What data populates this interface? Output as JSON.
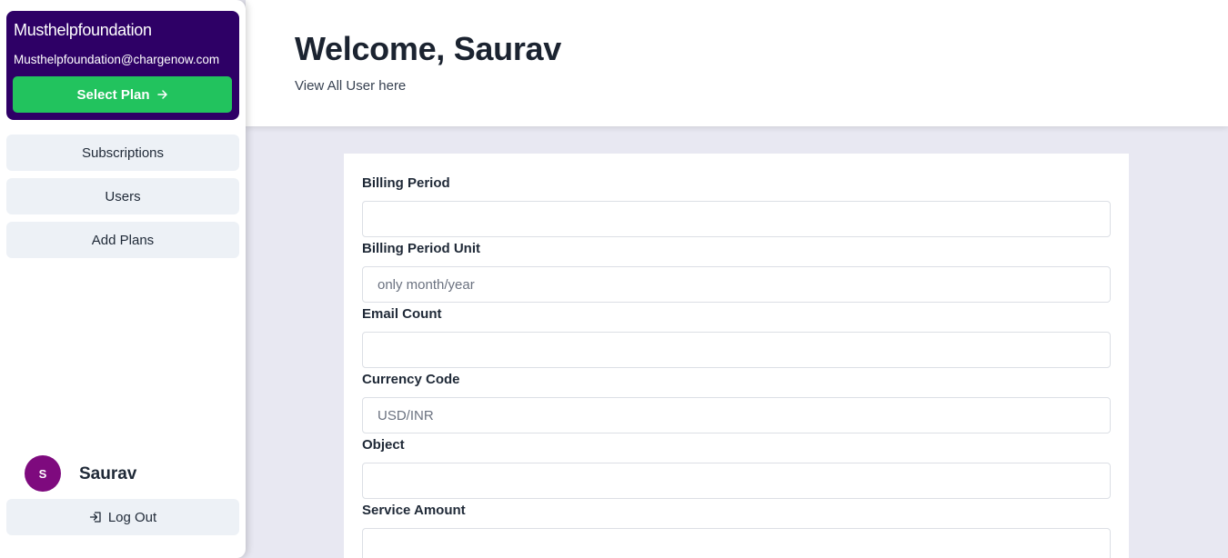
{
  "sidebar": {
    "org_name": "Musthelpfoundation",
    "org_email": "Musthelpfoundation@chargenow.com",
    "select_plan_label": "Select Plan",
    "nav": [
      {
        "label": "Subscriptions"
      },
      {
        "label": "Users"
      },
      {
        "label": "Add Plans"
      }
    ],
    "user": {
      "initial": "S",
      "name": "Saurav"
    },
    "logout_label": "Log Out"
  },
  "header": {
    "title": "Welcome, Saurav",
    "subtitle": "View All User here"
  },
  "form": {
    "fields": [
      {
        "label": "Billing Period",
        "placeholder": "",
        "value": ""
      },
      {
        "label": "Billing Period Unit",
        "placeholder": "only month/year",
        "value": ""
      },
      {
        "label": "Email Count",
        "placeholder": "",
        "value": ""
      },
      {
        "label": "Currency Code",
        "placeholder": "USD/INR",
        "value": ""
      },
      {
        "label": "Object",
        "placeholder": "",
        "value": ""
      },
      {
        "label": "Service Amount",
        "placeholder": "",
        "value": ""
      }
    ]
  },
  "colors": {
    "org_card": "#2e0066",
    "select_plan": "#22c35e",
    "avatar": "#7e0a7e",
    "content_bg": "#e8e8f2",
    "nav_button": "#edf1f6"
  },
  "icons": {
    "select_plan": "arrow-right-icon",
    "logout": "logout-icon"
  }
}
